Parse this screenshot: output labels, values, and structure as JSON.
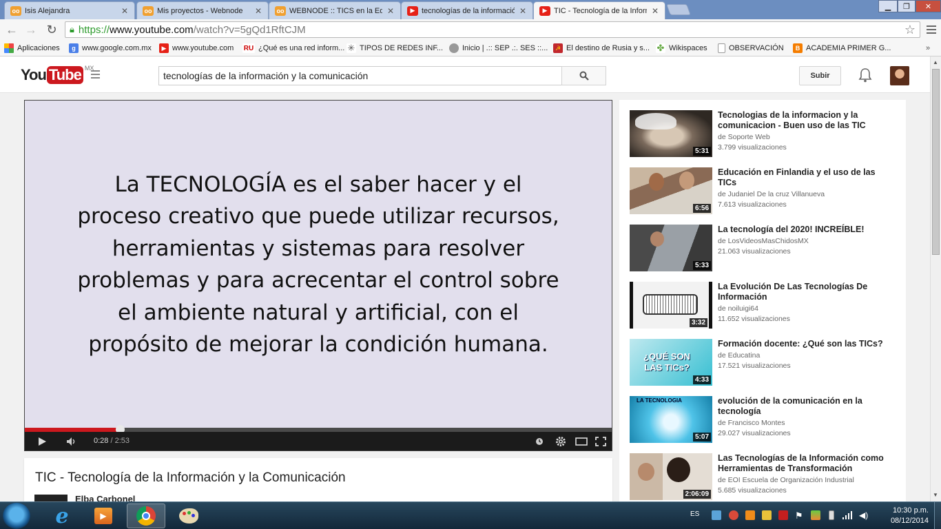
{
  "browser": {
    "tabs": [
      {
        "title": "Isis Alejandra",
        "favicon": "webnode-icon"
      },
      {
        "title": "Mis proyectos - Webnode",
        "favicon": "webnode-icon"
      },
      {
        "title": "WEBNODE :: TICS en la Edu",
        "favicon": "webnode-icon"
      },
      {
        "title": "tecnologías de la informació",
        "favicon": "youtube-icon"
      },
      {
        "title": "TIC - Tecnología de la Inform",
        "favicon": "youtube-icon"
      }
    ],
    "url": {
      "scheme": "https://",
      "host": "www.youtube.com",
      "path": "/watch?v=5gQd1RftCJM"
    },
    "bookmarks": [
      "Aplicaciones",
      "www.google.com.mx",
      "www.youtube.com",
      "¿Qué es una red inform...",
      "TIPOS DE REDES INF...",
      "Inicio | .:: SEP .:. SES ::...",
      "El destino de Rusia y s...",
      "Wikispaces",
      "OBSERVACIÓN",
      "ACADEMIA PRIMER G..."
    ]
  },
  "youtube": {
    "logo_you": "You",
    "logo_tube": "Tube",
    "logo_region": "MX",
    "search_query": "tecnologías de la información y la comunicación",
    "upload_label": "Subir"
  },
  "player": {
    "slide_text": "La TECNOLOGÍA es el saber hacer y el proceso creativo que puede utilizar recursos, herramientas y sistemas para resolver problemas y para acrecentar el control sobre el ambiente natural y artificial, con el propósito de mejorar la condición humana.",
    "current_time": "0:28",
    "duration": "/ 2:53",
    "progress_fraction": 0.1618
  },
  "video": {
    "title": "TIC - Tecnología de la Información y la Comunicación",
    "channel": "Elba Carbonel"
  },
  "related": [
    {
      "title": "Tecnologias de la informacion y la comunicacion - Buen uso de las TIC",
      "channel": "de Soporte Web",
      "views": "3.799 visualizaciones",
      "duration": "5:31"
    },
    {
      "title": "Educación en Finlandia y el uso de las TICs",
      "channel": "de Judaniel De la cruz Villanueva",
      "views": "7.613 visualizaciones",
      "duration": "6:56"
    },
    {
      "title": "La tecnología del 2020! INCREÍBLE!",
      "channel": "de LosVideosMasChidosMX",
      "views": "21.063 visualizaciones",
      "duration": "5:33"
    },
    {
      "title": "La Evolución De Las Tecnologías De Información",
      "channel": "de noiluigi64",
      "views": "11.652 visualizaciones",
      "duration": "3:32"
    },
    {
      "title": "Formación docente: ¿Qué son las TICs?",
      "channel": "de Educatina",
      "views": "17.521 visualizaciones",
      "duration": "4:33",
      "thumb_text": "¿QUÉ SON LAS TICs?"
    },
    {
      "title": "evolución de la comunicación en la tecnología",
      "channel": "de Francisco Montes",
      "views": "29.027 visualizaciones",
      "duration": "5:07",
      "thumb_text": "LA TECNOLOGIA"
    },
    {
      "title": "Las Tecnologías de la Información como Herramientas de Transformación",
      "channel": "de EOI Escuela de Organización Industrial",
      "views": "5.685 visualizaciones",
      "duration": "2:06:09"
    }
  ],
  "taskbar": {
    "language": "ES",
    "time": "10:30 p.m.",
    "date": "08/12/2014"
  },
  "colors": {
    "youtube_red": "#cc181e",
    "secure_green": "#2d9b2d",
    "slide_bg": "#e2dfed"
  }
}
